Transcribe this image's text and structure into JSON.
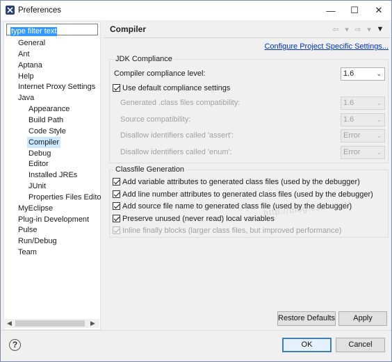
{
  "window": {
    "title": "Preferences",
    "minimize": "—",
    "maximize": "☐",
    "close": "✕",
    "icon": "eclipse-icon"
  },
  "filter": {
    "value": "type filter text"
  },
  "tree": {
    "items": [
      {
        "label": "General",
        "level": 1
      },
      {
        "label": "Ant",
        "level": 1
      },
      {
        "label": "Aptana",
        "level": 1
      },
      {
        "label": "Help",
        "level": 1
      },
      {
        "label": "Internet Proxy Settings",
        "level": 1
      },
      {
        "label": "Java",
        "level": 1
      },
      {
        "label": "Appearance",
        "level": 2
      },
      {
        "label": "Build Path",
        "level": 2
      },
      {
        "label": "Code Style",
        "level": 2
      },
      {
        "label": "Compiler",
        "level": 2,
        "selected": true
      },
      {
        "label": "Debug",
        "level": 2
      },
      {
        "label": "Editor",
        "level": 2
      },
      {
        "label": "Installed JREs",
        "level": 2
      },
      {
        "label": "JUnit",
        "level": 2
      },
      {
        "label": "Properties Files Edito",
        "level": 2
      },
      {
        "label": "MyEclipse",
        "level": 1
      },
      {
        "label": "Plug-in Development",
        "level": 1
      },
      {
        "label": "Pulse",
        "level": 1
      },
      {
        "label": "Run/Debug",
        "level": 1
      },
      {
        "label": "Team",
        "level": 1
      }
    ]
  },
  "page": {
    "title": "Compiler",
    "configure_link": "Configure Project Specific Settings..."
  },
  "jdk": {
    "group_label": "JDK Compliance",
    "compliance_level_label": "Compiler compliance level:",
    "compliance_level_value": "1.6",
    "use_default_label": "Use default compliance settings",
    "use_default_checked": true,
    "generated_label": "Generated .class files compatibility:",
    "generated_value": "1.6",
    "source_label": "Source compatibility:",
    "source_value": "1.6",
    "assert_label": "Disallow identifiers called 'assert':",
    "assert_value": "Error",
    "enum_label": "Disallow identifiers called 'enum':",
    "enum_value": "Error"
  },
  "classfile": {
    "group_label": "Classfile Generation",
    "options": [
      {
        "label": "Add variable attributes to generated class files (used by the debugger)",
        "checked": true,
        "enabled": true
      },
      {
        "label": "Add line number attributes to generated class files (used by the debugger)",
        "checked": true,
        "enabled": true
      },
      {
        "label": "Add source file name to generated class file (used by the debugger)",
        "checked": true,
        "enabled": true
      },
      {
        "label": "Preserve unused (never read) local variables",
        "checked": true,
        "enabled": true
      },
      {
        "label": "Inline finally blocks (larger class files, but improved performance)",
        "checked": true,
        "enabled": false
      }
    ]
  },
  "buttons": {
    "restore_defaults": "Restore Defaults",
    "apply": "Apply",
    "ok": "OK",
    "cancel": "Cancel"
  },
  "watermark": "http://blog.csdn.net/",
  "help_icon": "question-icon"
}
